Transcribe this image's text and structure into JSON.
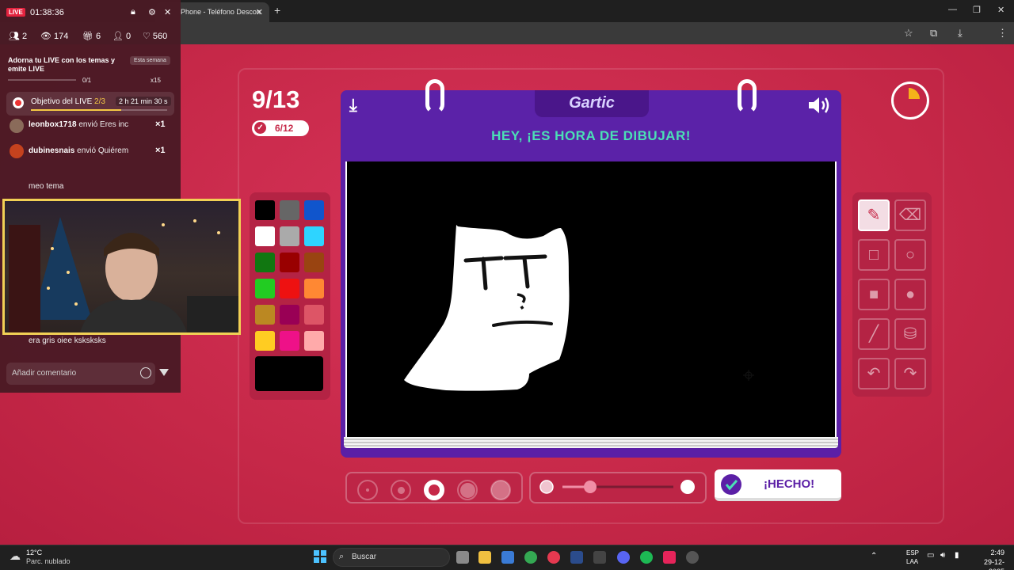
{
  "browser": {
    "tab_title": "Phone - Teléfono Descon",
    "tab_close": "✕",
    "new_tab": "+",
    "win_controls": [
      "—",
      "❐",
      "✕"
    ]
  },
  "game": {
    "round": "9/13",
    "progress_badge": "6/12",
    "logo": "Gartic",
    "instruction": "HEY, ¡ES HORA DE DIBUJAR!",
    "done_button": "¡HECHO!",
    "timer_elapsed_fraction": 0.12,
    "palette": [
      "#000000",
      "#666666",
      "#1055cc",
      "#ffffff",
      "#aaaaaa",
      "#2ed4ff",
      "#117711",
      "#990000",
      "#994411",
      "#22cc22",
      "#ee1111",
      "#ff8833",
      "#bb8822",
      "#990055",
      "#dd5566",
      "#ffcc22",
      "#ee1188",
      "#ffaaaa"
    ],
    "selected_color": "#000000",
    "tools": [
      "pencil-icon",
      "eraser-icon",
      "square-outline-icon",
      "circle-outline-icon",
      "square-filled-icon",
      "circle-filled-icon",
      "line-icon",
      "fill-bucket-icon",
      "undo-icon",
      "redo-icon"
    ],
    "active_tool": "pencil-icon",
    "brush_sizes": 5,
    "active_brush_size": 3,
    "opacity_level": 0.15
  },
  "live": {
    "badge": "LIVE",
    "time": "01:38:36",
    "stats": {
      "people": "2",
      "viewers": "174",
      "gifts": "6",
      "shares": "0",
      "likes": "560"
    },
    "promo_text": "Adorna tu LIVE con los temas y emite LIVE",
    "promo_tag": "Esta semana",
    "promo_progress": "0/1",
    "promo_reward": "x15",
    "goal_label": "Objetivo del LIVE ",
    "goal_count": "2/3",
    "goal_time": "2 h 21 min 30 s",
    "chat": [
      {
        "user": "leonbox1718",
        "text": " envió Eres inc",
        "count": "×1"
      },
      {
        "user": "dubinesnais",
        "text": " envió Quiérem",
        "count": "×1"
      },
      {
        "user": "",
        "text": "meo tema",
        "count": ""
      },
      {
        "user": "",
        "text": "era gris oiee ksksksks",
        "count": ""
      }
    ],
    "comment_placeholder": "Añadir comentario"
  },
  "taskbar": {
    "temp": "12°C",
    "weather": "Parc. nublado",
    "search": "Buscar",
    "lang_1": "ESP",
    "lang_2": "LAA",
    "time": "2:49",
    "date": "29-12-2025"
  }
}
